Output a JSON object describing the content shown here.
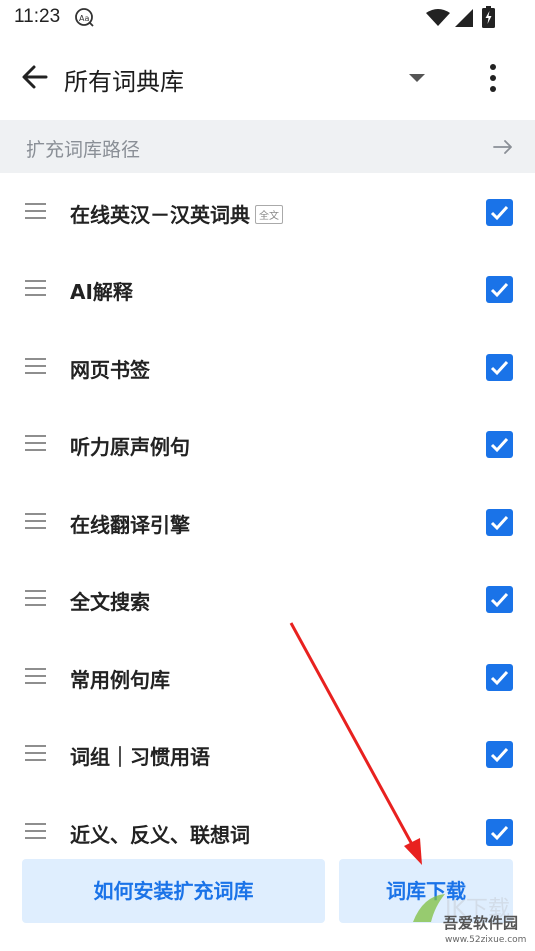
{
  "status_bar": {
    "time": "11:23"
  },
  "toolbar": {
    "title": "所有词典库"
  },
  "path_bar": {
    "label": "扩充词库路径"
  },
  "dictionaries": [
    {
      "name": "在线英汉－汉英词典",
      "badge": "全文",
      "checked": true
    },
    {
      "name": "AI解释",
      "checked": true
    },
    {
      "name": "网页书签",
      "checked": true
    },
    {
      "name": "听力原声例句",
      "checked": true
    },
    {
      "name": "在线翻译引擎",
      "checked": true
    },
    {
      "name": "全文搜索",
      "checked": true
    },
    {
      "name": "常用例句库",
      "checked": true
    },
    {
      "name": "词组｜习惯用语",
      "checked": true
    },
    {
      "name": "近义、反义、联想词",
      "checked": true
    }
  ],
  "buttons": {
    "how_to_install": "如何安装扩充词库",
    "download": "词库下载"
  },
  "watermark": {
    "site_name": "吾爱软件园",
    "url": "www.52zixue.com"
  },
  "colors": {
    "accent": "#1a73e8",
    "button_bg": "#dfeefe",
    "annotation_arrow": "#e8211f"
  }
}
